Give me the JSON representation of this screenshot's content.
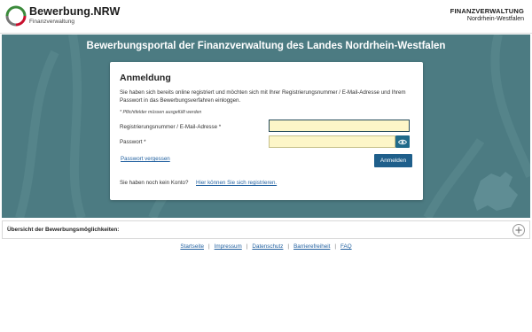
{
  "header": {
    "brand_title": "Bewerbung.NRW",
    "brand_subtitle": "Finanzverwaltung",
    "fv_title": "FINANZVERWALTUNG",
    "fv_subtitle": "Nordrhein-Westfalen"
  },
  "hero": {
    "title": "Bewerbungsportal der Finanzverwaltung des Landes Nordrhein-Westfalen"
  },
  "login": {
    "title": "Anmeldung",
    "intro": "Sie haben sich bereits online registriert und möchten sich mit Ihrer Registrierungsnummer / E-Mail-Adresse und Ihrem Passwort in das Bewerbungsverfahren einloggen.",
    "required_note": "* Pflichtfelder müssen ausgefüllt werden",
    "user_label": "Registrierungsnummer / E-Mail-Adresse *",
    "user_value": "",
    "password_label": "Passwort *",
    "password_value": "",
    "forgot_link": "Passwort vergessen",
    "submit_label": "Anmelden",
    "no_account_text": "Sie haben noch kein Konto?",
    "register_link": "Hier können Sie sich registrieren."
  },
  "accordion": {
    "label": "Übersicht der Bewerbungsmöglichkeiten:"
  },
  "footer": {
    "links": [
      "Startseite",
      "Impressum",
      "Datenschutz",
      "Barrierefreiheit",
      "FAQ"
    ],
    "separator": "|"
  },
  "colors": {
    "hero_bg": "#4c7b82",
    "primary_button": "#1f5f8b",
    "input_fill": "#fdf6c8",
    "link": "#1f5f9f"
  },
  "icons": {
    "logo": "bewerbung-nrw-logo",
    "password_toggle": "eye-icon",
    "expand": "plus-icon"
  }
}
